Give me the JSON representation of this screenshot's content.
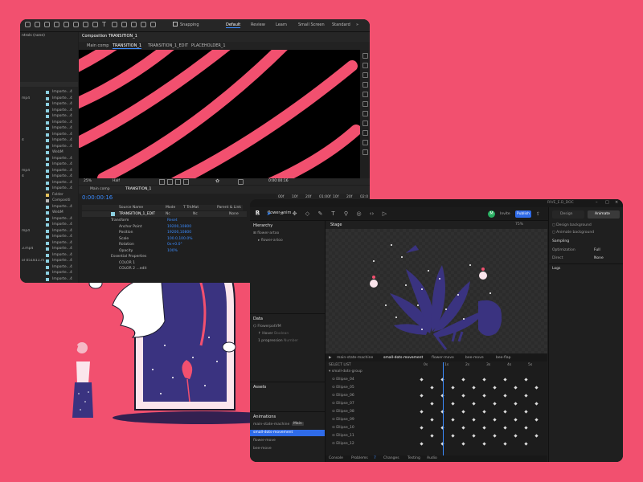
{
  "colors": {
    "background": "#f2506f",
    "accent_blue": "#3b8cff",
    "stripe_pink": "#f2506f",
    "illustration_navy": "#3a3380"
  },
  "ae": {
    "toolbar": {
      "snapping": "Snapping"
    },
    "workspaces": [
      "Default",
      "Review",
      "Learn",
      "Small Screen",
      "Standard"
    ],
    "project": {
      "title": "ntrols (none)",
      "items": [
        {
          "name": "Importe...4",
          "left": "",
          "icon": "file-icon"
        },
        {
          "name": "Importe...4",
          "left": "mp4",
          "icon": "file-icon"
        },
        {
          "name": "Importe...4",
          "left": "",
          "icon": "file-icon"
        },
        {
          "name": "Importe...4",
          "left": "",
          "icon": "file-icon"
        },
        {
          "name": "Importe...4",
          "left": "",
          "icon": "file-icon"
        },
        {
          "name": "Importe...4",
          "left": "",
          "icon": "file-icon"
        },
        {
          "name": "Importe...4",
          "left": "",
          "icon": "file-icon"
        },
        {
          "name": "Importe...4",
          "left": "",
          "icon": "file-icon"
        },
        {
          "name": "Importe...4",
          "left": "4",
          "icon": "file-icon"
        },
        {
          "name": "Importe...4",
          "left": "",
          "icon": "file-icon"
        },
        {
          "name": "WebM",
          "left": "",
          "icon": "file-icon"
        },
        {
          "name": "Importe...4",
          "left": "",
          "icon": "file-icon"
        },
        {
          "name": "Importe...4",
          "left": "",
          "icon": "file-icon"
        },
        {
          "name": "Importe...4",
          "left": "mp4",
          "icon": "file-icon"
        },
        {
          "name": "Importe...4",
          "left": "4",
          "icon": "file-icon"
        },
        {
          "name": "Importe...4",
          "left": "",
          "icon": "file-icon"
        },
        {
          "name": "Importe...4",
          "left": "",
          "icon": "file-icon"
        },
        {
          "name": "Folder",
          "left": "",
          "icon": "folder-icon"
        },
        {
          "name": "Compositi",
          "left": "",
          "icon": "comp-icon"
        },
        {
          "name": "Importe...4",
          "left": "",
          "icon": "file-icon"
        },
        {
          "name": "WebM",
          "left": "",
          "icon": "file-icon"
        },
        {
          "name": "Importe...4",
          "left": "",
          "icon": "file-icon"
        },
        {
          "name": "Importe...4",
          "left": "",
          "icon": "file-icon"
        },
        {
          "name": "Importe...4",
          "left": "mp4",
          "icon": "file-icon"
        },
        {
          "name": "Importe...4",
          "left": "",
          "icon": "file-icon"
        },
        {
          "name": "Importe...4",
          "left": "",
          "icon": "file-icon"
        },
        {
          "name": "Importe...4",
          "left": "3.mp4",
          "icon": "file-icon"
        },
        {
          "name": "Importe...4",
          "left": "",
          "icon": "file-icon"
        },
        {
          "name": "Importe...4",
          "left": "ol 051811.mp4",
          "icon": "file-icon"
        },
        {
          "name": "Importe...4",
          "left": "",
          "icon": "file-icon"
        },
        {
          "name": "Importe...4",
          "left": "",
          "icon": "file-icon"
        },
        {
          "name": "Importe...4",
          "left": "",
          "icon": "file-icon"
        }
      ]
    },
    "comp": {
      "panel_title": "Composition TRANSITION_1",
      "tabs": [
        "Main comp",
        "TRANSITION_1",
        "TRANSITION_1_EDIT",
        "PLACEHOLDER_1"
      ],
      "zoom": "25%",
      "resolution": "Half",
      "time": "0:00:00:16"
    },
    "timeline": {
      "tabs": [
        "Main comp",
        "TRANSITION_1"
      ],
      "timecode": "0:00:00:16",
      "columns": [
        "Source Name",
        "Mode",
        "T  TrkMat",
        "Parent & Link"
      ],
      "layer": {
        "name": "TRANSITION_1_EDIT",
        "mode": "Nc",
        "trkmat": "Nc",
        "parent": "None"
      },
      "props": [
        {
          "label": "Transform",
          "value": "Reset"
        },
        {
          "label": "Anchor Point",
          "value": "19200,10800"
        },
        {
          "label": "Position",
          "value": "19200,10800"
        },
        {
          "label": "Scale",
          "value": "100.0,100.0%"
        },
        {
          "label": "Rotation",
          "value": "0x+0.0°"
        },
        {
          "label": "Opacity",
          "value": "100%"
        },
        {
          "label": "Essential Properties",
          "value": ""
        },
        {
          "label": "COLOR 1",
          "value": ""
        },
        {
          "label": "COLOR 2 ...edit",
          "value": ""
        }
      ],
      "ruler": [
        "00f",
        "10f",
        "20f",
        "01:00f",
        "10f",
        "20f",
        "02:0"
      ]
    }
  },
  "rive": {
    "window_title": "RIVE_E.D_DOC",
    "file_name": "flower-anim",
    "user_initial": "M",
    "invite": "Invite",
    "publish": "Publish",
    "right_tabs": {
      "design": "Design",
      "animate": "Animate"
    },
    "right_options": [
      "Design background",
      "Animate background"
    ],
    "right_labels": {
      "sampling": "Sampling",
      "optimization": "Optimization",
      "optimization_value": "Full",
      "direct": "Direct",
      "direct_value": "None",
      "logs": "Logs"
    },
    "hierarchy": {
      "title": "Hierarchy",
      "items": [
        "flower-artoo",
        "flower-artoo"
      ]
    },
    "data": {
      "title": "Data",
      "items": [
        "FlowerpotVM",
        "Hover",
        "progression"
      ],
      "values": [
        "",
        "Boolean",
        "Number"
      ]
    },
    "assets": {
      "title": "Assets"
    },
    "animations": {
      "title": "Animations",
      "items": [
        "main-state-machine",
        "small-dots-movement",
        "flower-move",
        "bee-move"
      ],
      "tag": "Main"
    },
    "stage": {
      "title": "Stage",
      "zoom": "75%"
    },
    "anim_tabs": [
      "main-state-machine",
      "small-dots-movement",
      "flower-move",
      "bee-move",
      "bee-flap"
    ],
    "timeline_select": "SELECT LIST",
    "group": "small-dots-group",
    "layers": [
      "Ellipse_04",
      "Ellipse_05",
      "Ellipse_06",
      "Ellipse_07",
      "Ellipse_08",
      "Ellipse_09",
      "Ellipse_10",
      "Ellipse_11",
      "Ellipse_12"
    ],
    "ruler": [
      "0s",
      "1s",
      "2s",
      "3s",
      "4s",
      "5s"
    ],
    "timecode": "0:00/s",
    "bottom_tabs": [
      "Console",
      "Problems",
      "Changes",
      "Testing",
      "Audio"
    ],
    "problems_count": "7"
  }
}
